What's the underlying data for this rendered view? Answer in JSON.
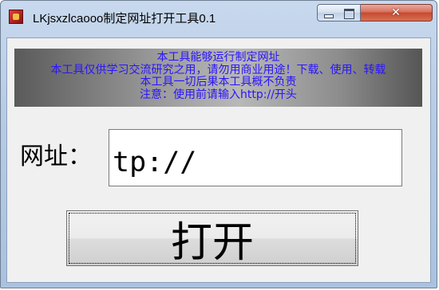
{
  "window": {
    "title": "LKjsxzlcaooo制定网址打开工具0.1",
    "close_glyph": "✕",
    "icons": {
      "app": "app-icon",
      "minimize": "minimize-icon",
      "maximize": "maximize-icon",
      "close": "close-icon"
    }
  },
  "banner": {
    "lines": [
      "本工具能够运行制定网址",
      "本工具仅供学习交流研究之用，请勿用商业用途！下载、使用、转载",
      "本工具一切后果本工具概不负责",
      "注意：使用前请输入http://开头"
    ],
    "text_color": "#2a14ff"
  },
  "form": {
    "url_label": "网址：",
    "url_value": "tp://",
    "open_button_label": "打开"
  }
}
